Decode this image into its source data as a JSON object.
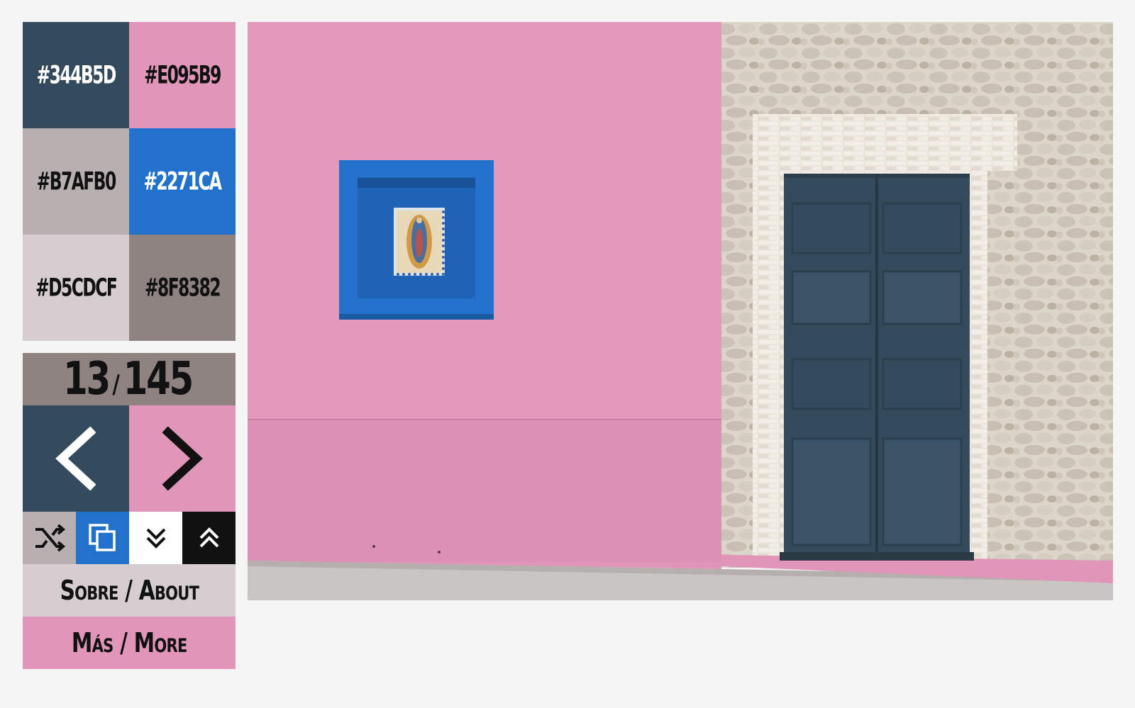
{
  "palette": {
    "swatches": [
      {
        "hex": "#344B5D",
        "label": "#344B5D",
        "text_color": "#ffffff"
      },
      {
        "hex": "#E095B9",
        "label": "#E095B9",
        "text_color": "#111111"
      },
      {
        "hex": "#B7AFB0",
        "label": "#B7AFB0",
        "text_color": "#111111"
      },
      {
        "hex": "#2271CA",
        "label": "#2271CA",
        "text_color": "#ffffff"
      },
      {
        "hex": "#D5CDCF",
        "label": "#D5CDCF",
        "text_color": "#111111"
      },
      {
        "hex": "#8F8382",
        "label": "#8F8382",
        "text_color": "#111111"
      }
    ]
  },
  "counter": {
    "current": "13",
    "separator": "/",
    "total": "145"
  },
  "navigation": {
    "prev_icon": "chevron-left-icon",
    "next_icon": "chevron-right-icon"
  },
  "tools": [
    {
      "name": "shuffle",
      "icon": "shuffle-icon"
    },
    {
      "name": "copy",
      "icon": "copy-icon"
    },
    {
      "name": "scroll-down",
      "icon": "double-chevron-down-icon"
    },
    {
      "name": "scroll-up",
      "icon": "double-chevron-up-icon"
    }
  ],
  "links": {
    "about_label": "Sobre / About",
    "more_label": "Más / More"
  },
  "colors": {
    "pink_wall": "#E095B9",
    "door": "#344B5D",
    "niche": "#2271CA",
    "stone": "#D5CDCF",
    "background": "#f5f5f5"
  }
}
